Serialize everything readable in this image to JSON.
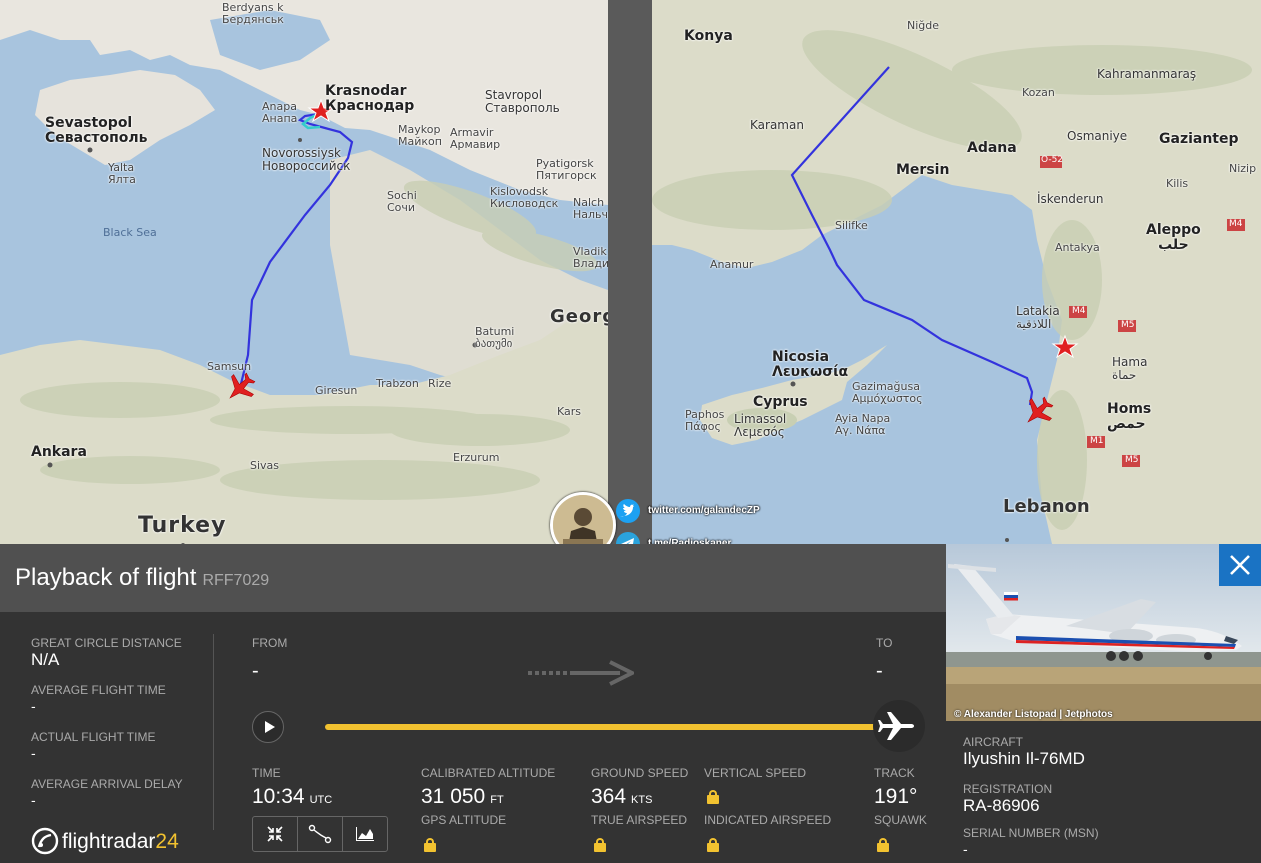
{
  "left_map": {
    "labels": {
      "berdyansk_en": "Berdyans k",
      "berdyansk_ru": "Бердянськ",
      "krasnodar_en": "Krasnodar",
      "krasnodar_ru": "Краснодар",
      "stavropol_en": "Stavropol",
      "stavropol_ru": "Ставрополь",
      "sevastopol_en": "Sevastopol",
      "sevastopol_ru": "Севастополь",
      "anapa_en": "Anapa",
      "anapa_ru": "Анапа",
      "maykop_en": "Maykop",
      "maykop_ru": "Майкоп",
      "armavir_en": "Armavir",
      "armavir_ru": "Армавир",
      "novorossiysk_en": "Novorossiysk",
      "novorossiysk_ru": "Новороссийск",
      "yalta_en": "Yalta",
      "yalta_ru": "Ялта",
      "pyatigorsk_en": "Pyatigorsk",
      "pyatigorsk_ru": "Пятигорск",
      "kislovodsk_en": "Kislovodsk",
      "kislovodsk_ru": "Кисловодск",
      "sochi_en": "Sochi",
      "sochi_ru": "Сочи",
      "nalch_en": "Nalch",
      "nalch_ru": "Нальч",
      "vladik_en": "Vladik",
      "vladik_ru": "Владик",
      "black_sea": "Black Sea",
      "batumi_en": "Batumi",
      "batumi_ka": "ბათუმი",
      "georgia": "Georg",
      "samsun": "Samsun",
      "giresun": "Giresun",
      "trabzon": "Trabzon",
      "rize": "Rize",
      "kars": "Kars",
      "ankara": "Ankara",
      "sivas": "Sivas",
      "erzurum": "Erzurum",
      "turkey": "Turkey"
    }
  },
  "right_map": {
    "labels": {
      "nigde": "Niğde",
      "konya": "Konya",
      "kahramanmaras": "Kahramanmaraş",
      "kozan": "Kozan",
      "karaman": "Karaman",
      "osmaniye": "Osmaniye",
      "gaziantep": "Gaziantep",
      "adana": "Adana",
      "mersin": "Mersin",
      "road_o52": "O-52",
      "nizip": "Nizip",
      "kilis": "Kilis",
      "silifke": "Silifke",
      "iskenderun": "İskenderun",
      "aleppo_en": "Aleppo",
      "aleppo_ar": "حلب",
      "road_m4_a": "M4",
      "anamur": "Anamur",
      "antakya": "Antakya",
      "latakia_en": "Latakia",
      "latakia_ar": "اللاذقية",
      "road_m4_b": "M4",
      "road_m5_a": "M5",
      "nicosia_en": "Nicosia",
      "nicosia_el": "Λευκωσία",
      "hama_en": "Hama",
      "hama_ar": "حماة",
      "gazimagusa_en": "Gazimağusa",
      "gazimagusa_el": "Αμμόχωστος",
      "cyprus": "Cyprus",
      "paphos_en": "Paphos",
      "paphos_el": "Πάφος",
      "limassol_en": "Limassol",
      "limassol_el": "Λεμεσός",
      "ayia_napa_en": "Ayia Napa",
      "ayia_napa_el": "Αγ. Νάπα",
      "homs_en": "Homs",
      "homs_ar": "حمص",
      "road_m1": "M1",
      "road_m5_b": "M5",
      "lebanon": "Lebanon"
    }
  },
  "social": {
    "twitter": "twitter.com/galandecZP",
    "telegram": "t.me/Radioskaner"
  },
  "panel": {
    "title": "Playback of flight",
    "flight_code": "RFF7029",
    "great_circle_label": "GREAT CIRCLE DISTANCE",
    "great_circle_value": "N/A",
    "avg_flight_label": "AVERAGE FLIGHT TIME",
    "avg_flight_value": "-",
    "actual_flight_label": "ACTUAL FLIGHT TIME",
    "actual_flight_value": "-",
    "avg_delay_label": "AVERAGE ARRIVAL DELAY",
    "avg_delay_value": "-",
    "from_label": "FROM",
    "from_value": "-",
    "to_label": "TO",
    "to_value": "-",
    "time_label": "TIME",
    "time_value": "10:34",
    "time_unit": "UTC",
    "cal_alt_label": "CALIBRATED ALTITUDE",
    "cal_alt_value": "31 050",
    "cal_alt_unit": "FT",
    "gps_alt_label": "GPS ALTITUDE",
    "ground_speed_label": "GROUND SPEED",
    "ground_speed_value": "364",
    "ground_speed_unit": "KTS",
    "true_airspeed_label": "TRUE AIRSPEED",
    "vertical_speed_label": "VERTICAL SPEED",
    "indicated_airspeed_label": "INDICATED AIRSPEED",
    "track_label": "TRACK",
    "track_value": "191°",
    "squawk_label": "SQUAWK",
    "playback_progress": 1.0
  },
  "aircraft": {
    "photo_credit": "© Alexander Listopad | Jetphotos",
    "aircraft_label": "AIRCRAFT",
    "aircraft_value": "Ilyushin Il-76MD",
    "registration_label": "REGISTRATION",
    "registration_value": "RA-86906",
    "serial_label": "SERIAL NUMBER (MSN)",
    "serial_value": "-",
    "tail_reg": "RA-86906"
  },
  "logo": {
    "text": "flightradar",
    "num": "24"
  },
  "colors": {
    "flight_path": "#3333dd",
    "flight_path_start": "#33cccc",
    "aircraft_marker": "#e02020",
    "accent_yellow": "#f2c230",
    "close_blue": "#1a73c4"
  }
}
